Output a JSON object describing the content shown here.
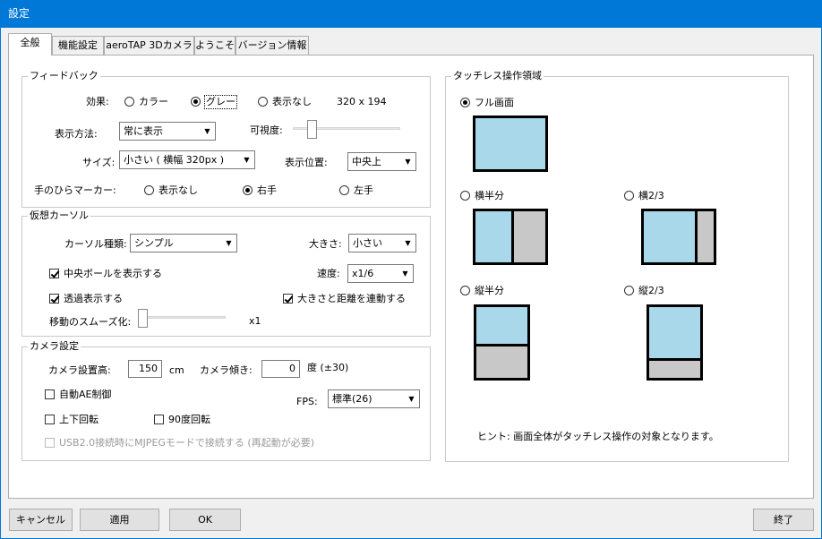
{
  "window": {
    "title": "設定"
  },
  "tabs": [
    "全般",
    "機能設定",
    "aeroTAP 3Dカメラ",
    "ようこそ",
    "バージョン情報"
  ],
  "feedback": {
    "group_label": "フィードバック",
    "effect_label": "効果:",
    "effect_options": [
      "カラー",
      "グレー",
      "表示なし"
    ],
    "effect_selected": "グレー",
    "resolution": "320 x 194",
    "display_method_label": "表示方法:",
    "display_method_value": "常に表示",
    "visibility_label": "可視度:",
    "visibility_value": 0.15,
    "size_label": "サイズ:",
    "size_value": "小さい ( 横幅 320px )",
    "position_label": "表示位置:",
    "position_value": "中央上",
    "palm_marker_label": "手のひらマーカー:",
    "palm_options": [
      "表示なし",
      "右手",
      "左手"
    ],
    "palm_selected": "右手"
  },
  "cursor": {
    "group_label": "仮想カーソル",
    "type_label": "カーソル種類:",
    "type_value": "シンプル",
    "size_label": "大きさ:",
    "size_value": "小さい",
    "center_ball_label": "中央ボールを表示する",
    "speed_label": "速度:",
    "speed_value": "x1/6",
    "transparent_label": "透過表示する",
    "link_label": "大きさと距離を連動する",
    "smooth_label": "移動のスムーズ化:",
    "smooth_value_text": "x1",
    "smooth_value": 0.0
  },
  "camera": {
    "group_label": "カメラ設定",
    "height_label": "カメラ設置高:",
    "height_value": "150",
    "height_unit": "cm",
    "tilt_label": "カメラ傾き:",
    "tilt_value": "0",
    "tilt_unit": "度 (±30)",
    "auto_ae_label": "自動AE制御",
    "fps_label": "FPS:",
    "fps_value": "標準(26)",
    "flip_label": "上下回転",
    "rotate90_label": "90度回転",
    "usb2_label": "USB2.0接続時にMJPEGモードで接続する (再起動が必要)"
  },
  "touchless": {
    "group_label": "タッチレス操作領域",
    "options": [
      "フル画面",
      "横半分",
      "横2/3",
      "縦半分",
      "縦2/3"
    ],
    "selected": "フル画面",
    "hint": "ヒント: 画面全体がタッチレス操作の対象となります。"
  },
  "buttons": {
    "cancel": "キャンセル",
    "apply": "適用",
    "ok": "OK",
    "exit": "終了"
  },
  "colors": {
    "accent": "#0078d7",
    "area_fill": "#a8d8ea",
    "area_other": "#c8c8c8"
  }
}
